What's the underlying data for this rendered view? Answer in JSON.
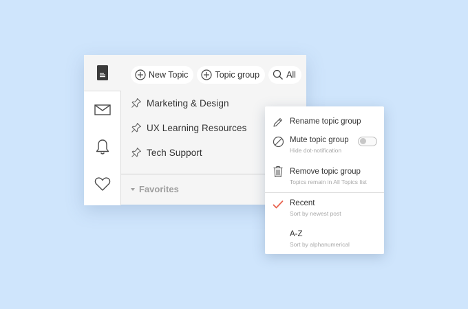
{
  "toolbar": {
    "new_topic": "New Topic",
    "topic_group": "Topic group",
    "all": "All"
  },
  "topics": [
    {
      "label": "Marketing & Design"
    },
    {
      "label": "UX Learning Resources"
    },
    {
      "label": "Tech Support"
    }
  ],
  "favorites": {
    "label": "Favorites"
  },
  "rail": {
    "icons": [
      "document-icon",
      "mail-icon",
      "bell-icon",
      "heart-icon"
    ]
  },
  "menu": {
    "rename": {
      "label": "Rename topic group"
    },
    "mute": {
      "label": "Mute topic group",
      "sub": "Hide dot-notification",
      "toggle_on": false
    },
    "remove": {
      "label": "Remove topic group",
      "sub": "Topics remain in All Topics list"
    },
    "recent": {
      "label": "Recent",
      "sub": "Sort by newest post",
      "checked": true
    },
    "az": {
      "label": "A-Z",
      "sub": "Sort by alphanumerical"
    }
  },
  "colors": {
    "background": "#cfe5fc",
    "panel": "#f5f5f5",
    "check": "#e8624e",
    "text": "#333333",
    "muted": "#9e9e9e"
  }
}
